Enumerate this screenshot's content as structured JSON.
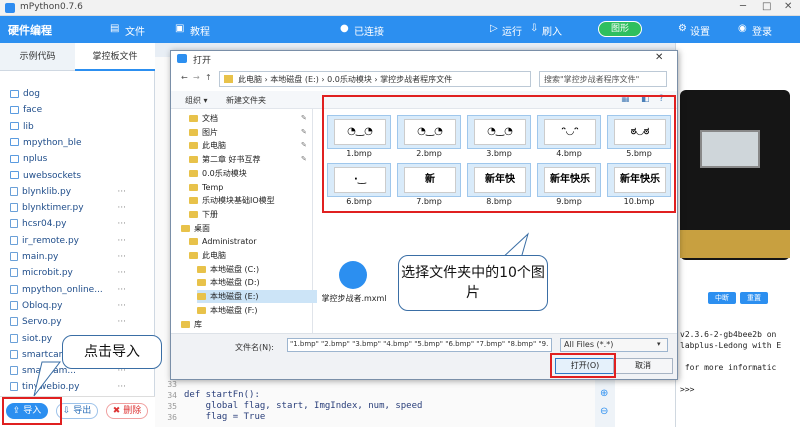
{
  "window": {
    "title": "mPython0.7.6",
    "min": "─",
    "max": "□",
    "close": "✕"
  },
  "toolbar": {
    "brand": "硬件编程",
    "file": "文件",
    "tutorial": "教程",
    "status": "已连接",
    "run": "运行",
    "flash": "刷入",
    "graphic": "图形",
    "settings": "设置",
    "login": "登录"
  },
  "sidebar": {
    "tabs": [
      "示例代码",
      "掌控板文件"
    ],
    "items": [
      {
        "name": "dog",
        "type": "folder"
      },
      {
        "name": "face",
        "type": "folder"
      },
      {
        "name": "lib",
        "type": "folder"
      },
      {
        "name": "mpython_ble",
        "type": "folder"
      },
      {
        "name": "nplus",
        "type": "folder"
      },
      {
        "name": "uwebsockets",
        "type": "folder"
      },
      {
        "name": "blynklib.py",
        "type": "file"
      },
      {
        "name": "blynktimer.py",
        "type": "file"
      },
      {
        "name": "hcsr04.py",
        "type": "file"
      },
      {
        "name": "ir_remote.py",
        "type": "file"
      },
      {
        "name": "main.py",
        "type": "file"
      },
      {
        "name": "microbit.py",
        "type": "file"
      },
      {
        "name": "mpython_online...",
        "type": "file"
      },
      {
        "name": "Obloq.py",
        "type": "file"
      },
      {
        "name": "Servo.py",
        "type": "file"
      },
      {
        "name": "siot.py",
        "type": "file"
      },
      {
        "name": "smartcam...",
        "type": "file"
      },
      {
        "name": "smartcam...",
        "type": "file"
      },
      {
        "name": "tinywebio.py",
        "type": "file"
      }
    ],
    "more": "···",
    "import": "导入",
    "export": "导出",
    "delete": "删除"
  },
  "editor": {
    "lines": [
      {
        "n": "33",
        "code": ""
      },
      {
        "n": "34",
        "code": "def startFn():"
      },
      {
        "n": "35",
        "code": "    global flag, start, ImgIndex, num, speed"
      },
      {
        "n": "36",
        "code": "    flag = True"
      }
    ]
  },
  "console": {
    "lines": [
      "v2.3.6-2-gb4bee2b on",
      "labplus-Ledong with E",
      "",
      " for more informatic",
      "",
      ">>>"
    ],
    "btn1": "中断",
    "btn2": "重置"
  },
  "dialog": {
    "title": "打开",
    "breadcrumb": [
      "此电脑",
      "本地磁盘 (E:)",
      "0.0乐动模块",
      "掌控步战者程序文件"
    ],
    "search_placeholder": "搜索\"掌控步战者程序文件\"",
    "organize": "组织 ▾",
    "new_folder": "新建文件夹",
    "nav": [
      {
        "label": "文档",
        "pinned": true
      },
      {
        "label": "图片",
        "pinned": true
      },
      {
        "label": "此电脑",
        "pinned": true
      },
      {
        "label": "第二章 好书互荐",
        "pinned": true
      },
      {
        "label": "0.0乐动模块",
        "pinned": false
      },
      {
        "label": "Temp",
        "pinned": false
      },
      {
        "label": "乐动模块基础IO模型",
        "pinned": false
      },
      {
        "label": "下册",
        "pinned": false
      },
      {
        "label": "桌面",
        "pinned": false
      },
      {
        "label": "Administrator",
        "pinned": false
      },
      {
        "label": "此电脑",
        "pinned": false
      },
      {
        "label": "本地磁盘 (C:)",
        "pinned": false
      },
      {
        "label": "本地磁盘 (D:)",
        "pinned": false
      },
      {
        "label": "本地磁盘 (E:)",
        "pinned": false
      },
      {
        "label": "本地磁盘 (F:)",
        "pinned": false
      },
      {
        "label": "库",
        "pinned": false
      }
    ],
    "files": [
      {
        "name": "1.bmp",
        "glyph": "◔‿◔"
      },
      {
        "name": "2.bmp",
        "glyph": "◔‿◔"
      },
      {
        "name": "3.bmp",
        "glyph": "◔‿◔"
      },
      {
        "name": "4.bmp",
        "glyph": "ᵔ◡ᵔ"
      },
      {
        "name": "5.bmp",
        "glyph": "ಠ◡ಠ"
      },
      {
        "name": "6.bmp",
        "glyph": "·‿"
      },
      {
        "name": "7.bmp",
        "glyph": "新"
      },
      {
        "name": "8.bmp",
        "glyph": "新年快"
      },
      {
        "name": "9.bmp",
        "glyph": "新年快乐"
      },
      {
        "name": "10.bmp",
        "glyph": "新年快乐"
      }
    ],
    "extra_file": "掌控步战者.mxml",
    "filename_label": "文件名(N):",
    "filename_value": "\"1.bmp\" \"2.bmp\" \"3.bmp\" \"4.bmp\" \"5.bmp\" \"6.bmp\" \"7.bmp\" \"8.bmp\" \"9.b",
    "filetype": "All Files (*.*)",
    "open": "打开(O)",
    "cancel": "取消"
  },
  "callouts": {
    "select": "选择文件夹中的10个图片",
    "import": "点击导入"
  },
  "colors": {
    "accent": "#2c8ff0",
    "highlight": "#e02020",
    "connected": "#2fbf5f"
  }
}
